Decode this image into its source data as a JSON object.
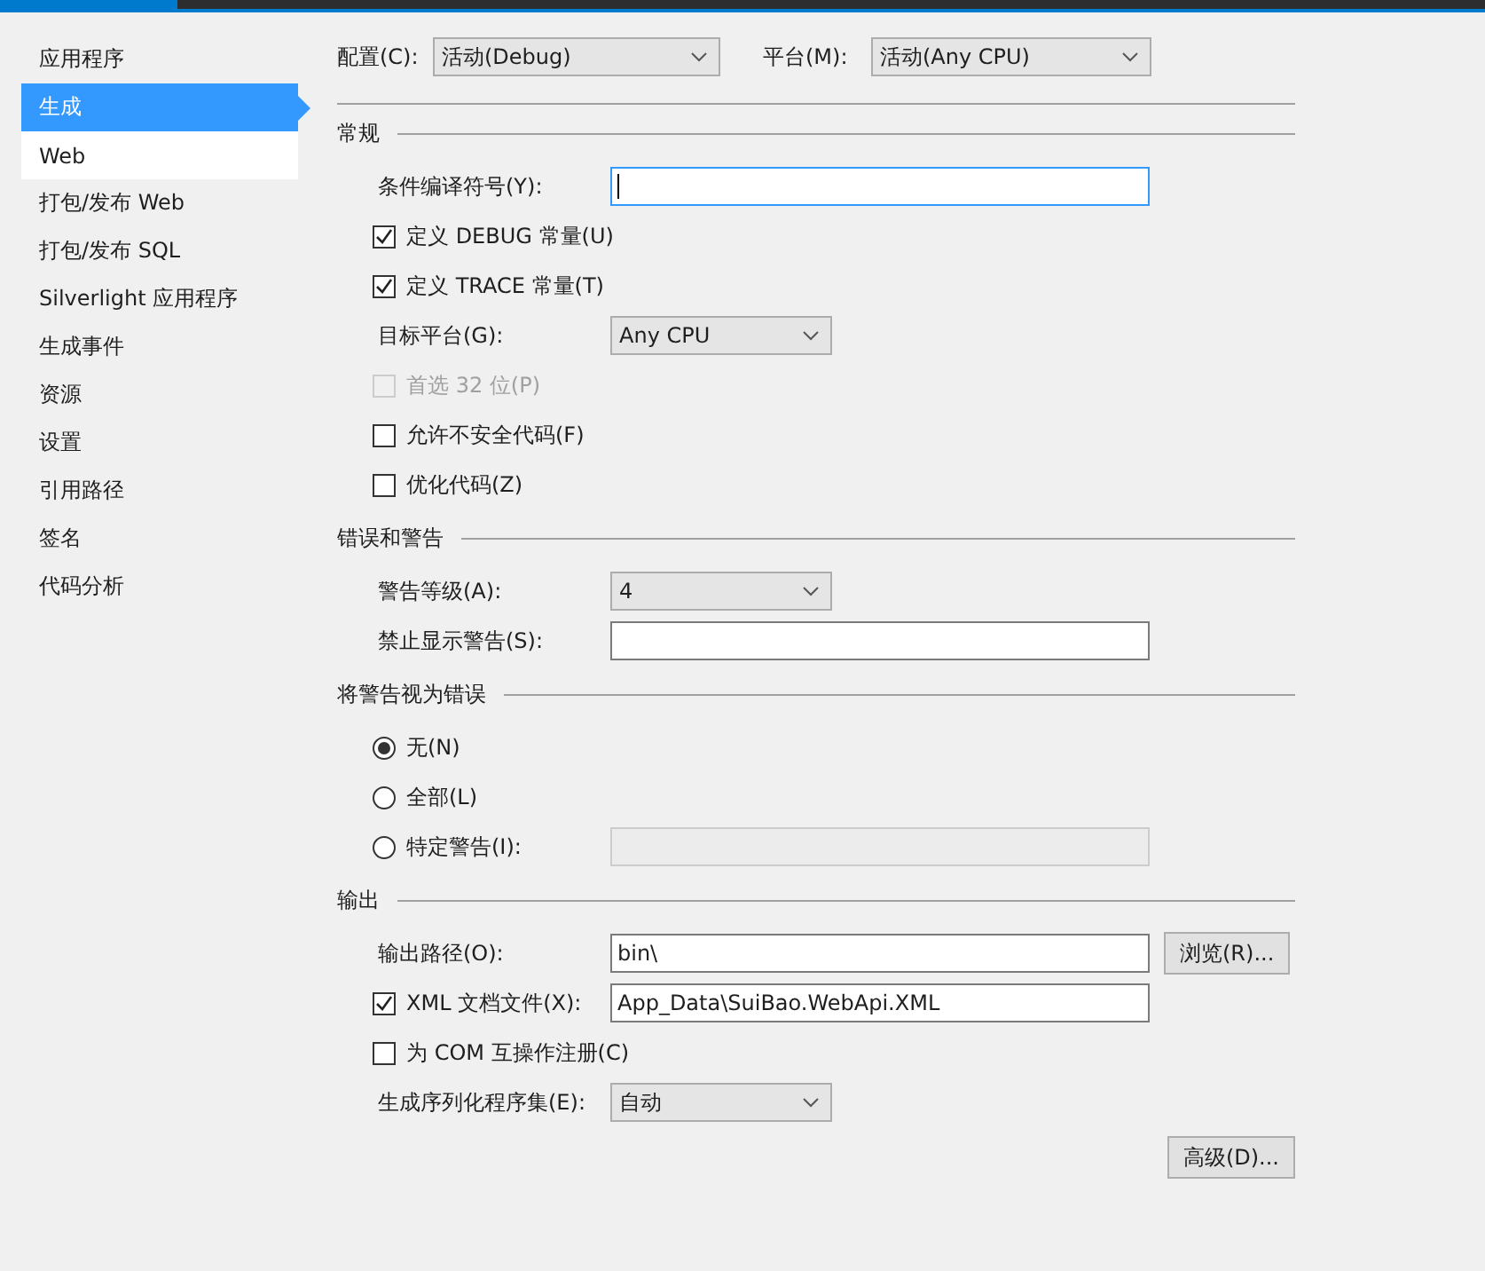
{
  "sidebar": {
    "items": [
      {
        "label": "应用程序",
        "selected": false,
        "hovered": false
      },
      {
        "label": "生成",
        "selected": true,
        "hovered": false
      },
      {
        "label": "Web",
        "selected": false,
        "hovered": true
      },
      {
        "label": "打包/发布 Web",
        "selected": false,
        "hovered": false
      },
      {
        "label": "打包/发布 SQL",
        "selected": false,
        "hovered": false
      },
      {
        "label": "Silverlight 应用程序",
        "selected": false,
        "hovered": false
      },
      {
        "label": "生成事件",
        "selected": false,
        "hovered": false
      },
      {
        "label": "资源",
        "selected": false,
        "hovered": false
      },
      {
        "label": "设置",
        "selected": false,
        "hovered": false
      },
      {
        "label": "引用路径",
        "selected": false,
        "hovered": false
      },
      {
        "label": "签名",
        "selected": false,
        "hovered": false
      },
      {
        "label": "代码分析",
        "selected": false,
        "hovered": false
      }
    ]
  },
  "toolbar": {
    "configuration": {
      "label": "配置(C):",
      "value": "活动(Debug)"
    },
    "platform": {
      "label": "平台(M):",
      "value": "活动(Any CPU)"
    }
  },
  "sections": [
    {
      "title": "常规",
      "rows": [
        {
          "kind": "field",
          "label": "条件编译符号(Y):",
          "focused": true
        },
        {
          "kind": "checkbox",
          "label": "定义 DEBUG 常量(U)",
          "checked": true,
          "disabled": false
        },
        {
          "kind": "checkbox",
          "label": "定义 TRACE 常量(T)",
          "checked": true,
          "disabled": false
        },
        {
          "kind": "select",
          "label": "目标平台(G):",
          "value": "Any CPU"
        },
        {
          "kind": "checkbox",
          "label": "首选 32 位(P)",
          "checked": false,
          "disabled": true
        },
        {
          "kind": "checkbox",
          "label": "允许不安全代码(F)",
          "checked": false,
          "disabled": false
        },
        {
          "kind": "checkbox",
          "label": "优化代码(Z)",
          "checked": false,
          "disabled": false
        }
      ]
    },
    {
      "title": "错误和警告",
      "rows": [
        {
          "kind": "select",
          "label": "警告等级(A):",
          "value": "4"
        },
        {
          "kind": "field",
          "label": "禁止显示警告(S):",
          "focused": false
        }
      ]
    },
    {
      "title": "将警告视为错误",
      "rows": [
        {
          "kind": "radio",
          "label": "无(N)",
          "selected": true
        },
        {
          "kind": "radio",
          "label": "全部(L)",
          "selected": false
        },
        {
          "kind": "radio",
          "label": "特定警告(I):",
          "selected": false,
          "field": {
            "disabled": true
          }
        }
      ]
    },
    {
      "title": "输出",
      "rows": [
        {
          "kind": "field",
          "label": "输出路径(O):",
          "value": "bin\\",
          "focused": false,
          "button": "浏览(R)..."
        },
        {
          "kind": "checkbox",
          "label": "XML 文档文件(X):",
          "checked": true,
          "disabled": false,
          "field": {
            "value": "App_Data\\SuiBao.WebApi.XML",
            "disabled": false
          }
        },
        {
          "kind": "checkbox",
          "label": "为 COM 互操作注册(C)",
          "checked": false,
          "disabled": false
        },
        {
          "kind": "select",
          "label": "生成序列化程序集(E):",
          "value": "自动"
        },
        {
          "kind": "button",
          "label": "高级(D)..."
        }
      ]
    }
  ]
}
